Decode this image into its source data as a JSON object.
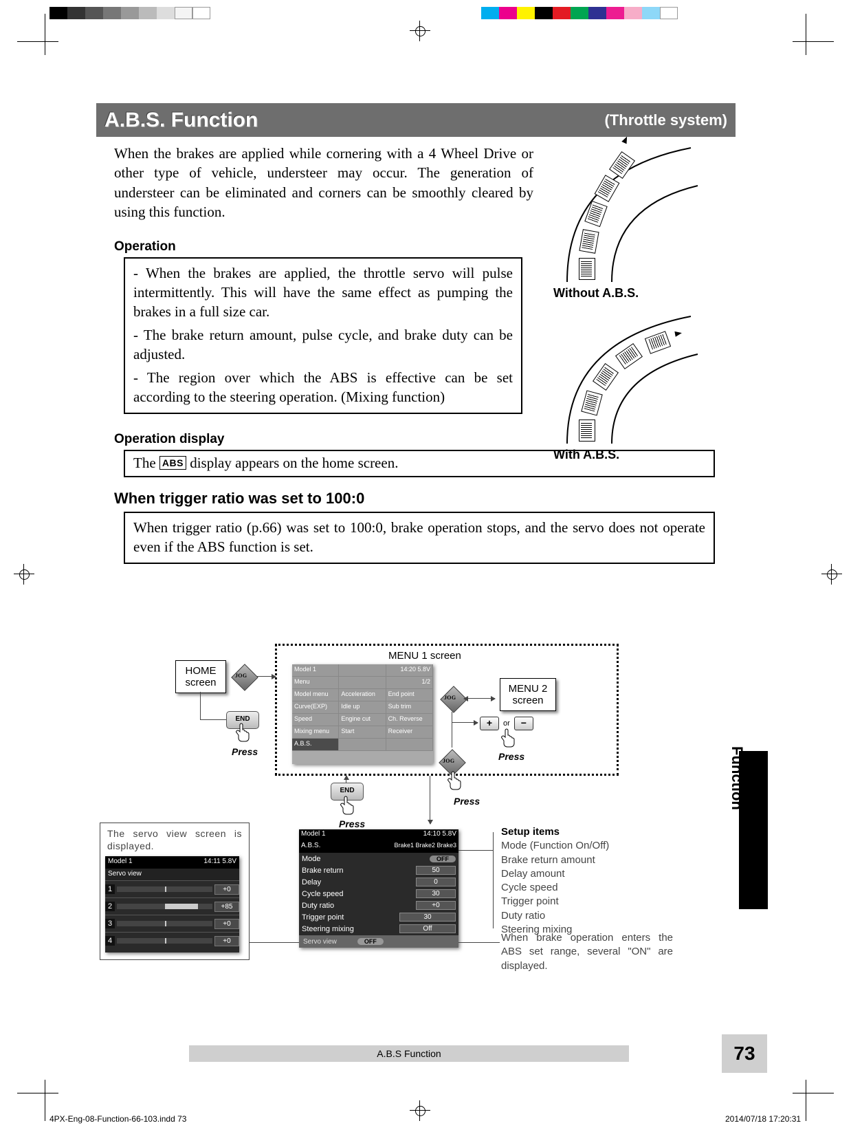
{
  "reg_colors_left_greys": [
    "#000",
    "#333",
    "#555",
    "#777",
    "#999",
    "#bbb",
    "#ddd",
    "#f4f4f4",
    "#fff"
  ],
  "reg_colors_right": [
    "#00aeef",
    "#ec008c",
    "#fff200",
    "#000000",
    "#e31b23",
    "#00a551",
    "#2e3192",
    "#ed1c91",
    "#f7adc8",
    "#8ed8f8",
    "#fff"
  ],
  "title": "A.B.S. Function",
  "subtitle": "(Throttle system)",
  "intro": "When the brakes are applied while cornering with a 4 Wheel Drive or other type of vehicle, understeer may occur. The generation of understeer can be eliminated and corners can be smoothly cleared by using this function.",
  "illus": {
    "without": "Without A.B.S.",
    "with": "With A.B.S."
  },
  "operation": {
    "heading": "Operation",
    "p1": "- When the brakes are applied, the throttle servo will pulse intermittently. This will have the same effect as pumping the brakes in a full size car.",
    "p2": "- The brake return amount, pulse cycle, and brake duty can be adjusted.",
    "p3": "- The region over which the ABS is effective can be set according to the steering operation. (Mixing function)"
  },
  "display": {
    "heading": "Operation display",
    "pre": "The ",
    "chip": "ABS",
    "post": " display appears on the home screen."
  },
  "trigger": {
    "heading": "When trigger ratio was set to 100:0",
    "body": "When trigger ratio (p.66) was set to 100:0, brake operation stops, and the servo does not operate even if the ABS function is set."
  },
  "diagram": {
    "home": "HOME\nscreen",
    "menu1_lbl": "MENU 1 screen",
    "menu2": "MENU 2\nscreen",
    "press": "Press",
    "or": "or",
    "jog": "JOG",
    "end": "END",
    "plus": "+",
    "minus": "−",
    "menu1_rows": [
      [
        "Model 1",
        "",
        "14:20 5.8V"
      ],
      [
        "Menu",
        "",
        "1/2"
      ],
      [
        "Model menu",
        "Acceleration",
        "End point"
      ],
      [
        "Curve(EXP)",
        "Idle up",
        "Sub trim"
      ],
      [
        "Speed",
        "Engine cut",
        "Ch. Reverse"
      ],
      [
        "Mixing menu",
        "Start",
        "Receiver"
      ],
      [
        "A.B.S.",
        "",
        ""
      ]
    ],
    "servo_note": "The servo view screen is displayed.",
    "servo": {
      "model": "Model 1",
      "status": "14:11 5.8V",
      "title": "Servo view",
      "rows": [
        {
          "n": "1",
          "val": "+0",
          "pos": 50,
          "w": 0
        },
        {
          "n": "2",
          "val": "+85",
          "pos": 50,
          "w": 35
        },
        {
          "n": "3",
          "val": "+0",
          "pos": 50,
          "w": 0
        },
        {
          "n": "4",
          "val": "+0",
          "pos": 50,
          "w": 0
        }
      ]
    },
    "abs": {
      "model": "Model 1",
      "status": "14:10 5.8V",
      "hd2l": "A.B.S.",
      "hd2r": "Brake1 Brake2 Brake3",
      "rows": [
        {
          "lbl": "Mode",
          "kind": "pill",
          "val": "OFF"
        },
        {
          "lbl": "Brake return",
          "kind": "val",
          "val": "50"
        },
        {
          "lbl": "Delay",
          "kind": "val",
          "val": "0"
        },
        {
          "lbl": "Cycle speed",
          "kind": "val",
          "val": "30"
        },
        {
          "lbl": "Duty ratio",
          "kind": "val",
          "val": "+0"
        },
        {
          "lbl": "Trigger point",
          "kind": "val",
          "val": "30"
        },
        {
          "lbl": "Steering mixing",
          "kind": "val",
          "val": "Off"
        }
      ],
      "servoview": "Servo view",
      "servopill": "OFF"
    },
    "setup": {
      "heading": "Setup items",
      "items": [
        "Mode (Function On/Off)",
        "Brake return amount",
        "Delay amount",
        "Cycle speed",
        "Trigger point",
        "Duty ratio",
        "Steering mixing"
      ]
    },
    "on_note": "When brake operation enters the ABS set range, several \"ON\" are displayed."
  },
  "footer": {
    "center": "A.B.S Function",
    "page": "73",
    "side": "Function",
    "file": "4PX-Eng-08-Function-66-103.indd   73",
    "ts": "2014/07/18   17:20:31"
  }
}
